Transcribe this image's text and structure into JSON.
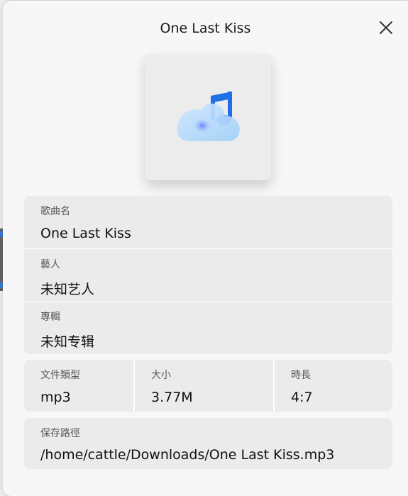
{
  "dialog": {
    "title": "One Last Kiss",
    "close_icon": "close-icon",
    "cover_icon": "music-cloud-icon"
  },
  "info": {
    "song_label": "歌曲名",
    "song_value": "One Last Kiss",
    "artist_label": "藝人",
    "artist_value": "未知艺人",
    "album_label": "專輯",
    "album_value": "未知专辑"
  },
  "meta": {
    "type_label": "文件類型",
    "type_value": "mp3",
    "size_label": "大小",
    "size_value": "3.77M",
    "duration_label": "時長",
    "duration_value": "4:7"
  },
  "path": {
    "label": "保存路徑",
    "value": "/home/cattle/Downloads/One Last Kiss.mp3"
  },
  "colors": {
    "dialog_bg": "#f7f7f7",
    "group_bg": "#ebebeb",
    "accent_blue": "#1f6fe6"
  }
}
